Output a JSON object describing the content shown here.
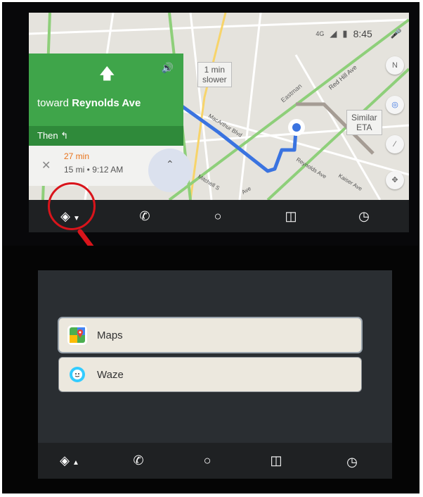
{
  "top_screen": {
    "status": {
      "network": "4G",
      "time": "8:45"
    },
    "nav_card": {
      "toward_prefix": "toward",
      "toward_street": "Reynolds Ave",
      "then_label": "Then",
      "eta_minutes": "27 min",
      "eta_detail": "15 mi • 9:12 AM"
    },
    "map_bubbles": {
      "slower_line1": "1 min",
      "slower_line2": "slower",
      "similar_line1": "Similar",
      "similar_line2": "ETA"
    },
    "street_labels": {
      "eastman": "Eastman",
      "red_hill": "Red Hill Ave",
      "macarthur": "MacArthur Blvd",
      "reynolds": "Reynolds Ave",
      "kaiser": "Kaiser Ave",
      "mitchell": "Mitchell S",
      "ave": "Ave"
    },
    "compass": "N"
  },
  "bottom_screen": {
    "apps": [
      {
        "label": "Maps",
        "icon": "google-maps-icon"
      },
      {
        "label": "Waze",
        "icon": "waze-icon"
      }
    ]
  },
  "navbar_icons": [
    "navigation-icon",
    "phone-icon",
    "home-circle-icon",
    "headphones-icon",
    "recent-icon"
  ],
  "colors": {
    "route_blue": "#3a73e0",
    "nav_green": "#3fa54a",
    "eta_orange": "#e8731b",
    "annotation_red": "#d9141b"
  }
}
